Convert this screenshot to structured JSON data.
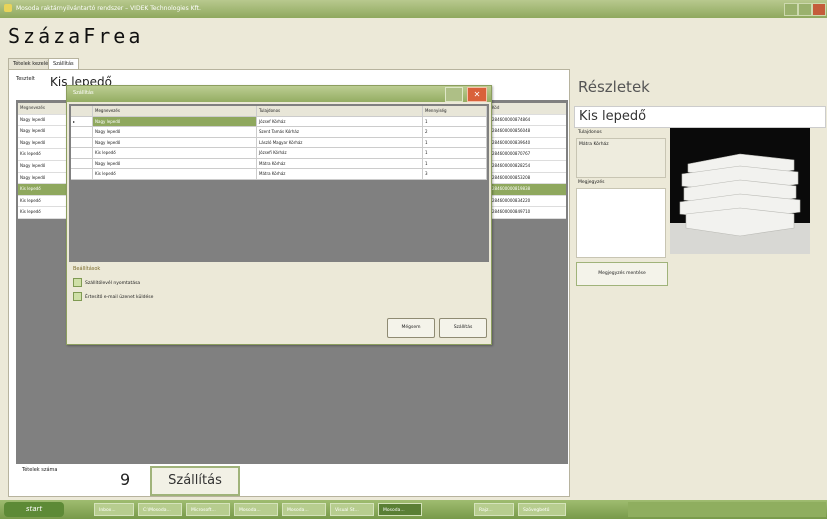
{
  "window": {
    "title": "Mosoda raktárnyilvántartó rendszer – VIDEK Technologies Kft."
  },
  "logo": "SzázaFrea",
  "tabs": [
    {
      "label": "Tételek kezelés"
    },
    {
      "label": "Szállítás"
    }
  ],
  "left_panel": {
    "label": "Tesztelt",
    "partial_title": "Kis lepedő",
    "grid_header": "Megnevezés",
    "grid_right_header": "Kód",
    "rows": [
      "Nagy lepedő",
      "Nagy lepedő",
      "Nagy lepedő",
      "Kis lepedő",
      "Nagy lepedő",
      "Nagy lepedő",
      "Kis lepedő",
      "Kis lepedő",
      "Kis lepedő"
    ],
    "selected_index": 6,
    "codes": [
      "284600000874864",
      "284600000856048",
      "284600000839640",
      "284600000870767",
      "284600000828254",
      "284600000853208",
      "284600000819838",
      "284600000834220",
      "284600000849710"
    ]
  },
  "footer": {
    "label": "Tételek száma",
    "count": "9",
    "button": "Szállítás"
  },
  "dialog": {
    "title": "Szállítás",
    "columns": [
      "Megnevezés",
      "Tulajdonos",
      "Mennyiség"
    ],
    "rows": [
      {
        "name": "Nagy lepedő",
        "owner": "József Kórház",
        "qty": "1"
      },
      {
        "name": "Nagy lepedő",
        "owner": "Szent Tamás Kórház",
        "qty": "2"
      },
      {
        "name": "Nagy lepedő",
        "owner": "László Magyar Kórház",
        "qty": "1"
      },
      {
        "name": "Kis lepedő",
        "owner": "Józsefi Kórház",
        "qty": "1"
      },
      {
        "name": "Nagy lepedő",
        "owner": "Mátra Kórház",
        "qty": "1"
      },
      {
        "name": "Kis lepedő",
        "owner": "Mátra Kórház",
        "qty": "3"
      }
    ],
    "options_title": "Beállítások",
    "options": [
      "Szállítólevél nyomtatása",
      "Értesítő e-mail üzenet küldése"
    ],
    "buttons": {
      "cancel": "Mégsem",
      "ship": "Szállítás"
    }
  },
  "details": {
    "heading": "Részletek",
    "title": "Kis lepedő",
    "owner_label": "Tulajdonos",
    "owner_value": "Mátra Kórház",
    "notes_label": "Megjegyzés",
    "notes_button": "Megjegyzés mentése"
  },
  "taskbar": {
    "start": "start",
    "tasks": [
      "Inbox...",
      "C:\\Mosoda...",
      "Microsoft...",
      "Mosoda...",
      "Mosoda...",
      "Visual St...",
      "Mosoda...",
      "Rajz...",
      "Szövegbetű"
    ]
  }
}
